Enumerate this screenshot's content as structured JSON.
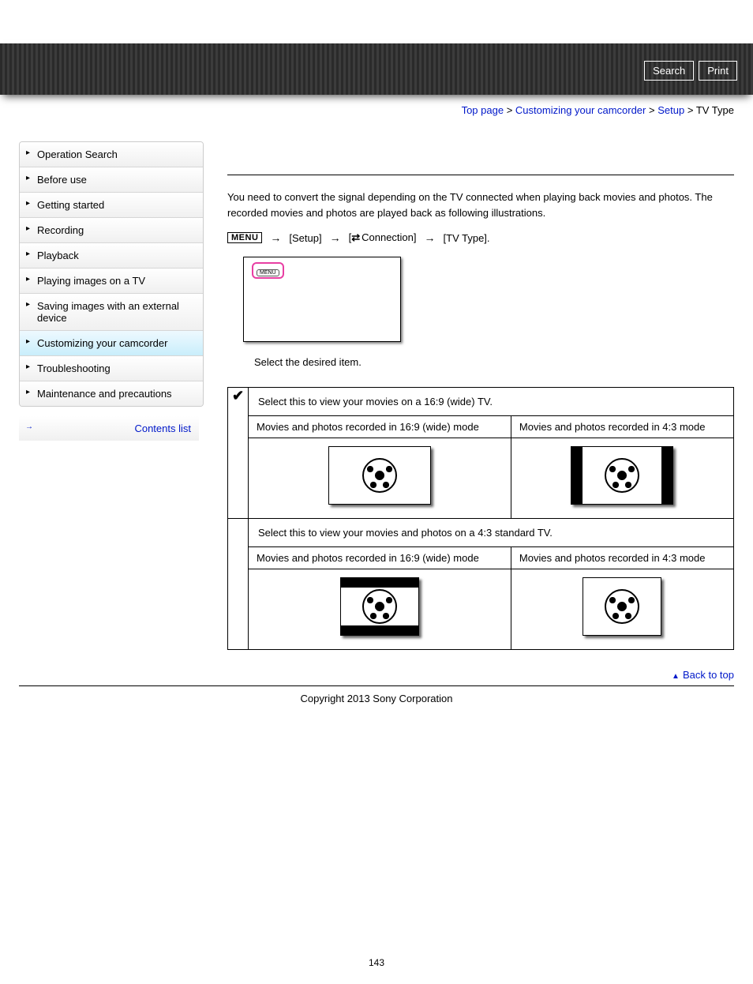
{
  "header": {
    "search_label": "Search",
    "print_label": "Print"
  },
  "breadcrumb": {
    "items": [
      "Top page",
      "Customizing your camcorder",
      "Setup"
    ],
    "current": "TV Type",
    "sep": ">"
  },
  "sidebar": {
    "items": [
      {
        "label": "Operation Search"
      },
      {
        "label": "Before use"
      },
      {
        "label": "Getting started"
      },
      {
        "label": "Recording"
      },
      {
        "label": "Playback"
      },
      {
        "label": "Playing images on a TV"
      },
      {
        "label": "Saving images with an external device"
      },
      {
        "label": "Customizing your camcorder"
      },
      {
        "label": "Troubleshooting"
      },
      {
        "label": "Maintenance and precautions"
      }
    ],
    "active_index": 7,
    "contents_list": "Contents list"
  },
  "main": {
    "intro": "You need to convert the signal depending on the TV connected when playing back movies and photos. The recorded movies and photos are played back as following illustrations.",
    "menu_button": "MENU",
    "path": {
      "setup": "[Setup]",
      "connection": "Connection]",
      "tvtype": "[TV Type]."
    },
    "screen_button": "MENU",
    "select_caption": "Select the desired item.",
    "col_16_9": "Movies and photos recorded in 16:9 (wide) mode",
    "col_4_3": "Movies and photos recorded in 4:3 mode",
    "option_wide": {
      "desc": "Select this to view your movies on a 16:9 (wide) TV."
    },
    "option_std": {
      "desc": "Select this to view your movies and photos on a 4:3 standard TV."
    }
  },
  "footer": {
    "back_to_top": "Back to top",
    "copyright": "Copyright 2013 Sony Corporation",
    "page_number": "143"
  }
}
